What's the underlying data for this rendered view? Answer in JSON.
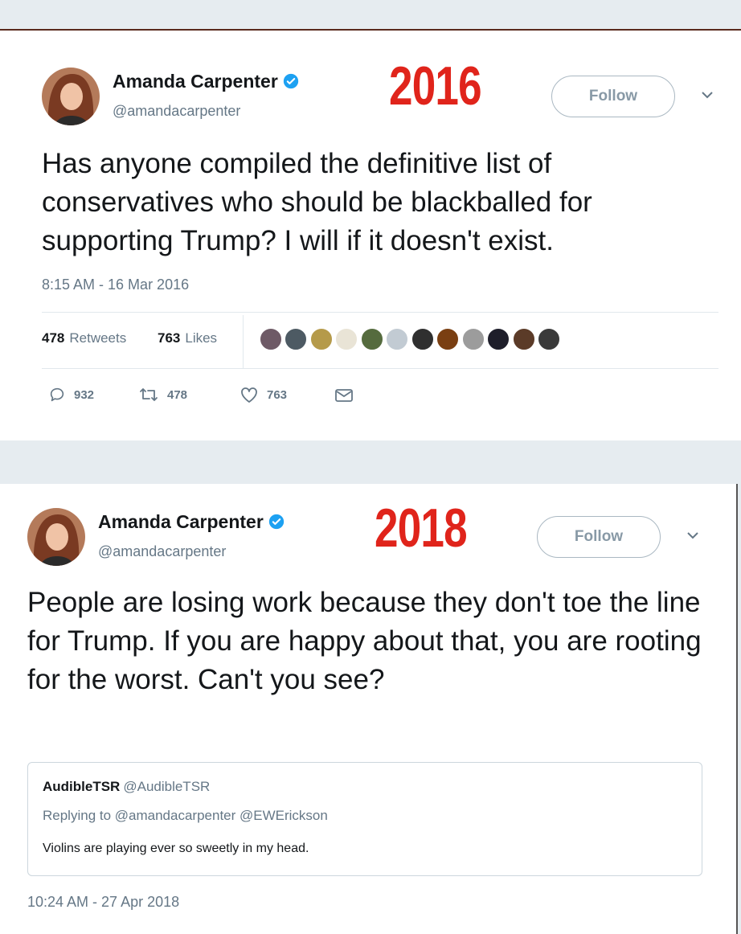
{
  "tweets": [
    {
      "year": "2016",
      "name": "Amanda Carpenter",
      "handle": "@amandacarpenter",
      "follow_label": "Follow",
      "text": "Has anyone compiled the definitive list of conservatives who should be blackballed for supporting Trump? I will if it doesn't exist.",
      "timestamp": "8:15 AM - 16 Mar 2016",
      "retweets_count": "478",
      "retweets_label": "Retweets",
      "likes_count": "763",
      "likes_label": "Likes",
      "actions": {
        "reply_count": "932",
        "retweet_count": "478",
        "like_count": "763"
      }
    },
    {
      "year": "2018",
      "name": "Amanda Carpenter",
      "handle": "@amandacarpenter",
      "follow_label": "Follow",
      "text": "People are losing work because they don't toe the line for Trump. If you are happy about that, you are rooting for the worst. Can't you see?",
      "quote": {
        "name": "AudibleTSR",
        "handle": "@AudibleTSR",
        "replying_to": "Replying to @amandacarpenter @EWErickson",
        "text": "Violins are playing ever so sweetly in my head."
      },
      "timestamp": "10:24 AM - 27 Apr 2018"
    }
  ],
  "colors": {
    "year_red": "#e0241b",
    "verified_blue": "#1da1f2",
    "muted": "#657786"
  },
  "icons": [
    "verified-badge-icon",
    "chevron-down-icon",
    "reply-icon",
    "retweet-icon",
    "like-icon",
    "message-icon"
  ]
}
